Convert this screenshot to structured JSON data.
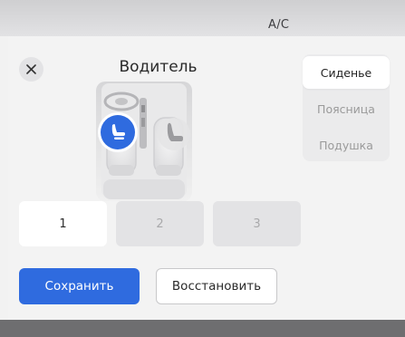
{
  "header": {
    "ac_label": "A/C"
  },
  "dialog": {
    "title": "Водитель",
    "close_icon": "close-icon"
  },
  "seat_illustration": {
    "highlight_color": "#2f6bdf",
    "seat_icon": "seat-icon"
  },
  "side_tabs": [
    {
      "label": "Сиденье",
      "active": true
    },
    {
      "label": "Поясница",
      "active": false
    },
    {
      "label": "Подушка",
      "active": false
    }
  ],
  "presets": [
    {
      "label": "1",
      "active": true
    },
    {
      "label": "2",
      "active": false
    },
    {
      "label": "3",
      "active": false
    }
  ],
  "actions": {
    "save_label": "Сохранить",
    "restore_label": "Восстановить"
  },
  "colors": {
    "accent": "#2f6bdf",
    "background": "#f3f3f3",
    "bottom_bar": "#6e6e70"
  }
}
